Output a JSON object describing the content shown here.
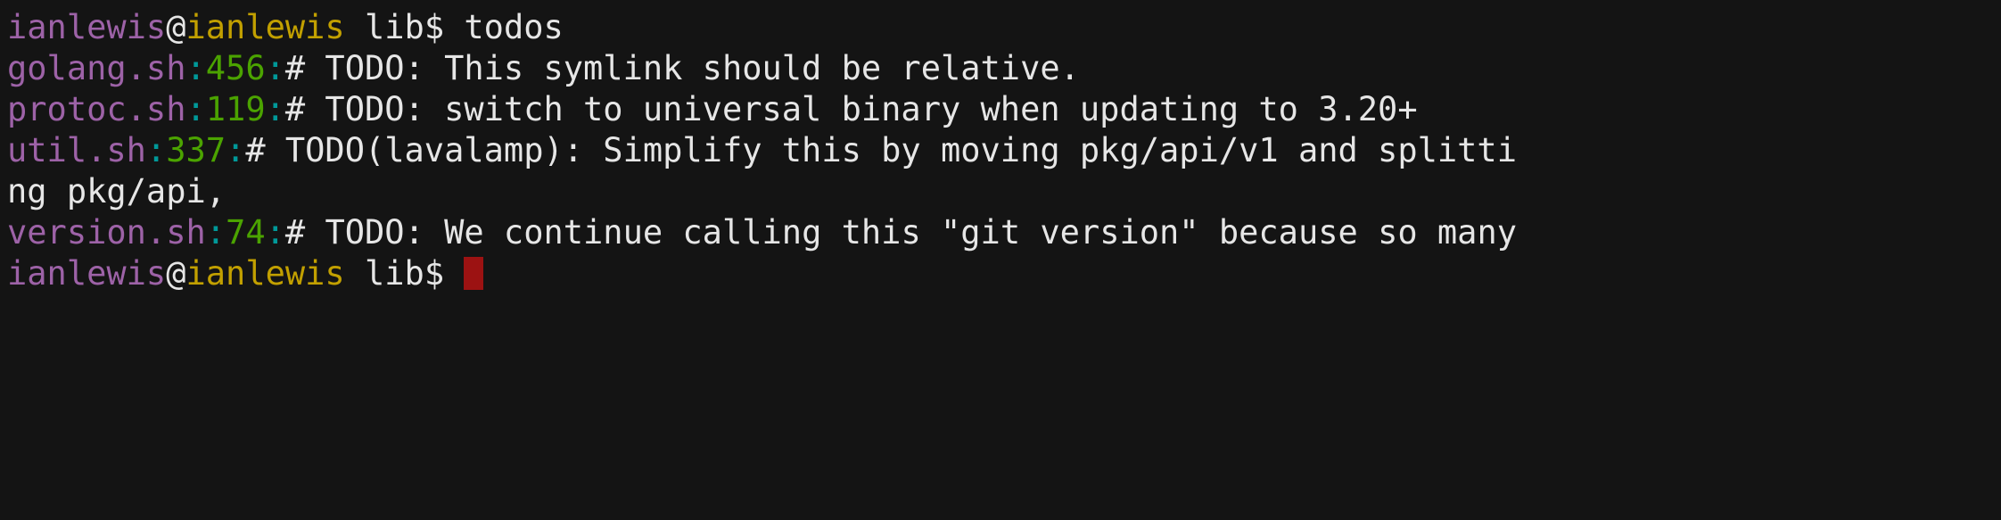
{
  "terminal": {
    "background_color": "#141414",
    "foreground_color": "#e6e6e6",
    "colors": {
      "username": "#9d62a7",
      "hostname": "#c2a000",
      "filename": "#9d62a7",
      "separator": "#009999",
      "linenumber": "#4ba300",
      "text": "#e6e6e6",
      "cursor": "#9c1212"
    },
    "prompt": {
      "user": "ianlewis",
      "at": "@",
      "host": "ianlewis",
      "cwd": "lib$"
    },
    "command": "todos",
    "results": [
      {
        "file": "golang.sh",
        "sep1": ":",
        "line": "456",
        "sep2": ":",
        "text": "# TODO: This symlink should be relative."
      },
      {
        "file": "protoc.sh",
        "sep1": ":",
        "line": "119",
        "sep2": ":",
        "text": "# TODO: switch to universal binary when updating to 3.20+"
      },
      {
        "file": "util.sh",
        "sep1": ":",
        "line": "337",
        "sep2": ":",
        "text": "# TODO(lavalamp): Simplify this by moving pkg/api/v1 and splitti"
      },
      {
        "file": "",
        "sep1": "",
        "line": "",
        "sep2": "",
        "text": "ng pkg/api,"
      },
      {
        "file": "version.sh",
        "sep1": ":",
        "line": "74",
        "sep2": ":",
        "text": "# TODO: We continue calling this \"git version\" because so many"
      }
    ]
  }
}
